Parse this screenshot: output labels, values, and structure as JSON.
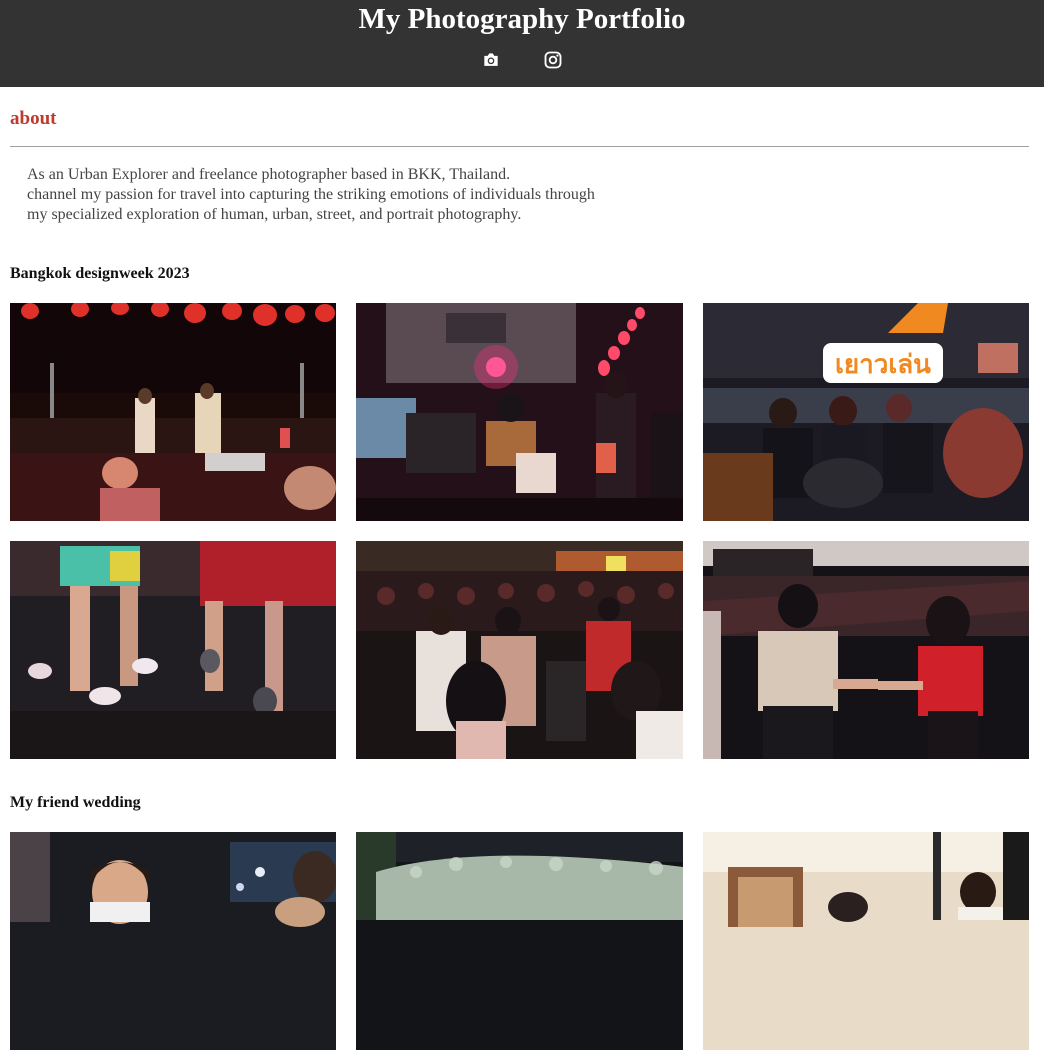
{
  "header": {
    "title": "My Photography Portfolio",
    "icons": [
      "camera-icon",
      "instagram-icon"
    ]
  },
  "about": {
    "heading": "about",
    "lines": [
      "As an Urban Explorer and freelance photographer based in BKK, Thailand.",
      "channel my passion for travel into capturing the striking emotions of individuals through",
      "my specialized exploration of human, urban, street, and portrait photography."
    ]
  },
  "galleries": [
    {
      "title": "Bangkok designweek 2023",
      "photos": [
        {
          "subject": "concert-stage-singers"
        },
        {
          "subject": "guitarist-stage-red-light"
        },
        {
          "subject": "orchestra-with-sign",
          "sign_text": "เยาวเล่น"
        },
        {
          "subject": "dancing-feet"
        },
        {
          "subject": "night-crowd"
        },
        {
          "subject": "couple-dancing"
        }
      ]
    },
    {
      "title": "My friend wedding",
      "photos": [
        {
          "subject": "smiling-woman-night"
        },
        {
          "subject": "hedge-night"
        },
        {
          "subject": "wedding-interior"
        }
      ]
    }
  ],
  "colors": {
    "header_bg": "#333333",
    "accent": "#c0392b"
  }
}
